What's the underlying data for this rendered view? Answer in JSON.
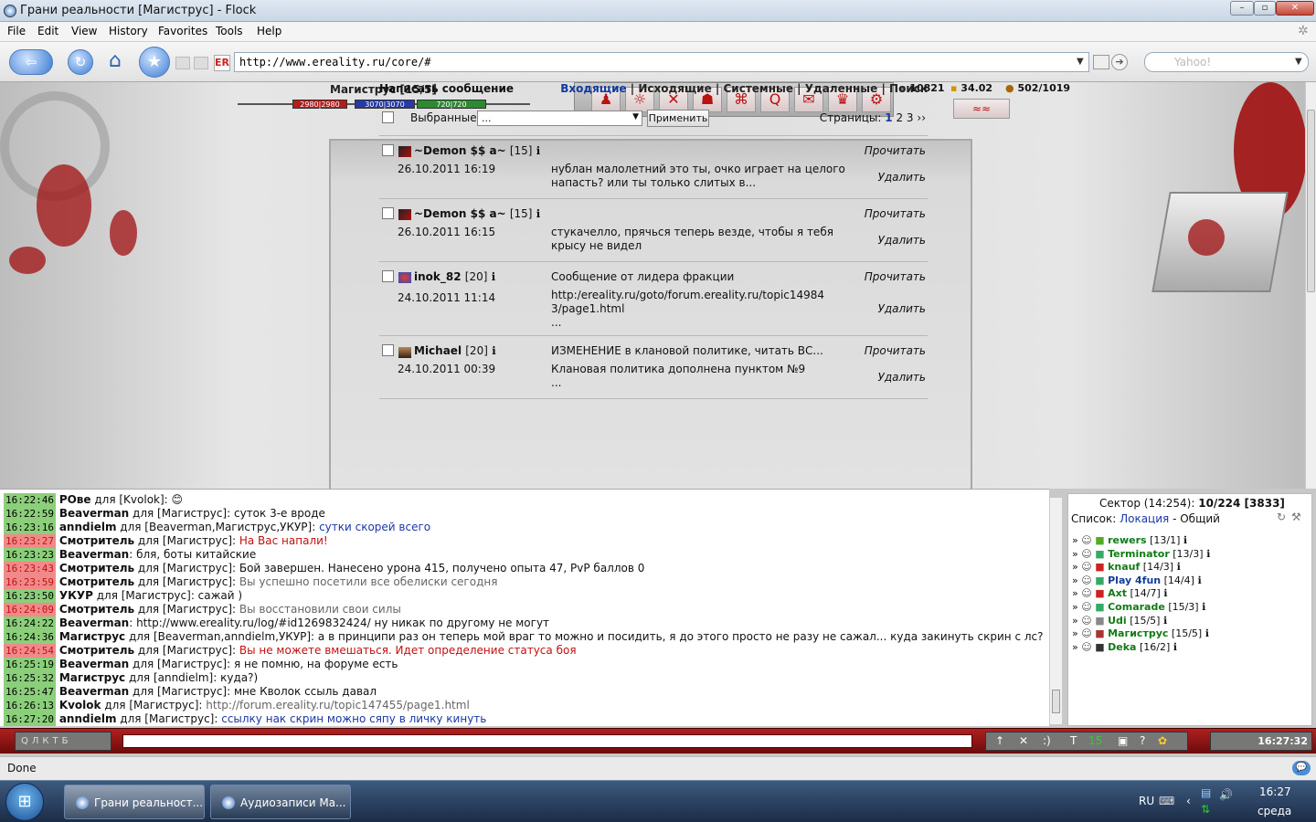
{
  "window": {
    "title": "Грани реальности [Магиструс] - Flock"
  },
  "menu": [
    "File",
    "Edit",
    "View",
    "History",
    "Favorites",
    "Tools",
    "Help"
  ],
  "browser": {
    "url": "http://www.ereality.ru/core/#",
    "search_placeholder": "Yahoo!",
    "status": "Done"
  },
  "character": {
    "name": "Магиструс [15/5]",
    "hp": "2980|2980",
    "mp": "3070|3070",
    "en": "720|720",
    "stat1": "10821",
    "stat2": "34.02",
    "stat3": "502/1019"
  },
  "mail": {
    "compose": "Написать сообщение",
    "tabs": [
      "Входящие",
      "Исходящие",
      "Системные",
      "Удаленные",
      "Поиск"
    ],
    "selected_label": "Выбранные",
    "select_value": "...",
    "apply": "Применить",
    "pages_label": "Страницы:",
    "pages": [
      "1",
      "2",
      "3",
      "››"
    ],
    "read_label": "Прочитать",
    "delete_label": "Удалить",
    "messages": [
      {
        "author": "~Demon $$ a~",
        "level": "[15]",
        "date": "26.10.2011 16:19",
        "subject": "",
        "text": "нублан малолетний это ты, очко играет на целого напасть? или ты только слитых в..."
      },
      {
        "author": "~Demon $$ a~",
        "level": "[15]",
        "date": "26.10.2011 16:15",
        "subject": "",
        "text": "стукачелло, прячься теперь везде, чтобы я тебя крысу не видел"
      },
      {
        "author": "inok_82",
        "level": "[20]",
        "date": "24.10.2011 11:14",
        "subject": "Сообщение от лидера фракции",
        "text": "http:/ereality.ru/goto/forum.ereality.ru/topic149843/page1.html",
        "text2": "..."
      },
      {
        "author": "Michael",
        "level": "[20]",
        "date": "24.10.2011 00:39",
        "subject": "ИЗМЕНЕНИЕ в клановой политике, читать ВС...",
        "text": "Клановая политика дополнена пунктом №9",
        "text2": "..."
      }
    ]
  },
  "chat": [
    {
      "time": "16:22:46",
      "alert": false,
      "nick": "PОве",
      "to": " для [Kvolok]:",
      "msg": " 😊",
      "cls": ""
    },
    {
      "time": "16:22:59",
      "alert": false,
      "nick": "Beaverman",
      "to": " для [Магиструс]:",
      "msg": " суток 3-е вроде",
      "cls": ""
    },
    {
      "time": "16:23:16",
      "alert": false,
      "nick": "anndielm",
      "to": " для [Beaverman,Магиструс,УКУР]:",
      "msg": " сутки скорей всего",
      "cls": "blue"
    },
    {
      "time": "16:23:27",
      "alert": true,
      "nick": "Смотритель",
      "to": " для [Магиструс]:",
      "msg": " На Вас напали!",
      "cls": "red"
    },
    {
      "time": "16:23:23",
      "alert": false,
      "nick": "Beaverman",
      "to": ":",
      "msg": " бля, боты китайские",
      "cls": ""
    },
    {
      "time": "16:23:43",
      "alert": true,
      "nick": "Смотритель",
      "to": " для [Магиструс]:",
      "msg": " Бой завершен. Нанесено урона 415, получено опыта 47, PvP баллов 0",
      "cls": ""
    },
    {
      "time": "16:23:59",
      "alert": true,
      "nick": "Смотритель",
      "to": " для [Магиструс]:",
      "msg": " Вы успешно посетили все обелиски сегодня",
      "cls": "grey"
    },
    {
      "time": "16:23:50",
      "alert": false,
      "nick": "УКУР",
      "to": " для [Магиструс]:",
      "msg": " сажай )",
      "cls": ""
    },
    {
      "time": "16:24:09",
      "alert": true,
      "nick": "Смотритель",
      "to": " для [Магиструс]:",
      "msg": " Вы восстановили свои силы",
      "cls": "grey"
    },
    {
      "time": "16:24:22",
      "alert": false,
      "nick": "Beaverman",
      "to": ":",
      "msg": " http://www.ereality.ru/log/#id1269832424/ ну никак по другому не могут",
      "cls": ""
    },
    {
      "time": "16:24:36",
      "alert": false,
      "nick": "Магиструс",
      "to": " для [Beaverman,anndielm,УКУР]:",
      "msg": " а в принципи раз он теперь мой враг то можно и посидить, я до этого просто не разу не сажал... куда закинуть скрин с лс?",
      "cls": ""
    },
    {
      "time": "16:24:54",
      "alert": true,
      "nick": "Смотритель",
      "to": " для [Магиструс]:",
      "msg": " Вы не можете вмешаться. Идет определение статуса боя",
      "cls": "red"
    },
    {
      "time": "16:25:19",
      "alert": false,
      "nick": "Beaverman",
      "to": " для [Магиструс]:",
      "msg": " я не помню, на форуме есть",
      "cls": ""
    },
    {
      "time": "16:25:32",
      "alert": false,
      "nick": "Магиструс",
      "to": " для [anndielm]:",
      "msg": " куда?)",
      "cls": ""
    },
    {
      "time": "16:25:47",
      "alert": false,
      "nick": "Beaverman",
      "to": " для [Магиструс]:",
      "msg": " мне Кволок ссыль давал",
      "cls": ""
    },
    {
      "time": "16:26:13",
      "alert": false,
      "nick": "Kvolok",
      "to": " для [Магиструс]:",
      "msg": " http://forum.ereality.ru/topic147455/page1.html",
      "cls": "grey"
    },
    {
      "time": "16:27:20",
      "alert": false,
      "nick": "anndielm",
      "to": " для [Магиструс]:",
      "msg": " ссылку нак скрин можно сяпу в личку кинуть",
      "cls": "blue"
    }
  ],
  "sidebar": {
    "sector": "Сектор (14:254):",
    "count": "10/224 [3833]",
    "list_label": "Список:",
    "list_loc": "Локация",
    "list_sep": " - ",
    "list_all": "Общий",
    "players": [
      {
        "name": "rewers",
        "lvl": "[13/1]"
      },
      {
        "name": "Terminator",
        "lvl": "[13/3]"
      },
      {
        "name": "knauf",
        "lvl": "[14/3]"
      },
      {
        "name": "Play 4fun",
        "lvl": "[14/4]"
      },
      {
        "name": "Axt",
        "lvl": "[14/7]"
      },
      {
        "name": "Comarade",
        "lvl": "[15/3]"
      },
      {
        "name": "Udi",
        "lvl": "[15/5]"
      },
      {
        "name": "Магиструс",
        "lvl": "[15/5]"
      },
      {
        "name": "Deka",
        "lvl": "[16/2]"
      }
    ]
  },
  "inputbar": {
    "keys": [
      "Q",
      "Л",
      "К",
      "Т",
      "Б"
    ],
    "count": "15",
    "clock": "16:27:32"
  },
  "taskbar": {
    "items": [
      "Грани реальност...",
      "Аудиозаписи Ма..."
    ],
    "lang": "RU",
    "time": "16:27",
    "day": "среда"
  }
}
